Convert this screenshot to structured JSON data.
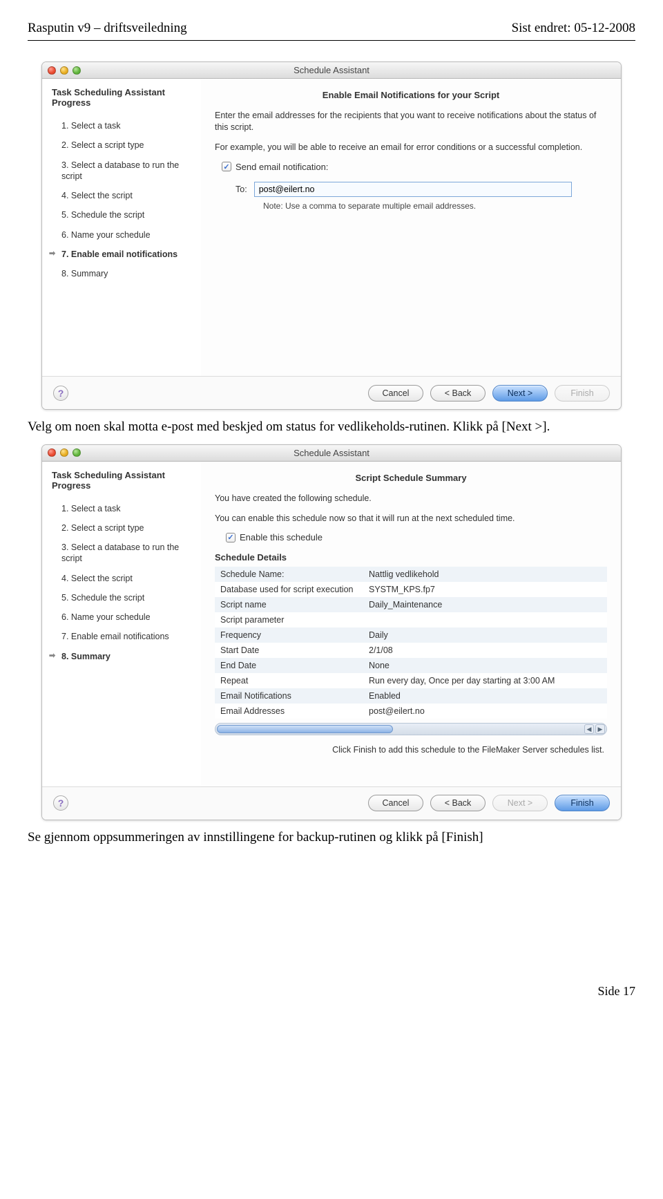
{
  "doc_header": {
    "left": "Rasputin v9 – driftsveiledning",
    "right": "Sist endret: 05-12-2008"
  },
  "dialog1": {
    "title": "Schedule Assistant",
    "sidebar_heading": "Task Scheduling Assistant Progress",
    "steps": [
      "1. Select a task",
      "2. Select a script type",
      "3. Select a database to run the script",
      "4. Select the script",
      "5. Schedule the script",
      "6. Name your schedule",
      "7. Enable email notifications",
      "8. Summary"
    ],
    "active_step_index": 6,
    "main_heading": "Enable Email Notifications for your Script",
    "para1": "Enter the email addresses for the recipients that you want to receive notifications about the status of this script.",
    "para2": "For example, you will be able to receive an email for error conditions or a successful completion.",
    "checkbox_label": "Send email notification:",
    "to_label": "To:",
    "to_value": "post@eilert.no",
    "note": "Note: Use a comma to separate multiple email addresses.",
    "buttons": {
      "cancel": "Cancel",
      "back": "< Back",
      "next": "Next >",
      "finish": "Finish"
    }
  },
  "body_text_1": "Velg om noen skal motta e-post med beskjed om status for vedlikeholds-rutinen. Klikk på [Next >].",
  "dialog2": {
    "title": "Schedule Assistant",
    "sidebar_heading": "Task Scheduling Assistant Progress",
    "steps": [
      "1. Select a task",
      "2. Select a script type",
      "3. Select a database to run the script",
      "4. Select the script",
      "5. Schedule the script",
      "6. Name your schedule",
      "7. Enable email notifications",
      "8. Summary"
    ],
    "active_step_index": 7,
    "main_heading": "Script Schedule Summary",
    "para1": "You have created the following schedule.",
    "para2": "You can enable this schedule now so that it will run at the next scheduled time.",
    "checkbox_label": "Enable this schedule",
    "details_title": "Schedule Details",
    "details": [
      {
        "label": "Schedule Name:",
        "value": "Nattlig vedlikehold"
      },
      {
        "label": "Database used for script execution",
        "value": "SYSTM_KPS.fp7"
      },
      {
        "label": "Script name",
        "value": "Daily_Maintenance"
      },
      {
        "label": "Script parameter",
        "value": ""
      },
      {
        "label": "Frequency",
        "value": "Daily"
      },
      {
        "label": "Start Date",
        "value": "2/1/08"
      },
      {
        "label": "End Date",
        "value": "None"
      },
      {
        "label": "Repeat",
        "value": "Run every day, Once per day starting at 3:00 AM"
      },
      {
        "label": "Email Notifications",
        "value": "Enabled"
      },
      {
        "label": "Email Addresses",
        "value": "post@eilert.no"
      }
    ],
    "finish_hint": "Click Finish to add this schedule to the FileMaker Server schedules list.",
    "buttons": {
      "cancel": "Cancel",
      "back": "< Back",
      "next": "Next >",
      "finish": "Finish"
    }
  },
  "body_text_2": "Se gjennom oppsummeringen av innstillingene for backup-rutinen og klikk på [Finish]",
  "footer": "Side 17"
}
